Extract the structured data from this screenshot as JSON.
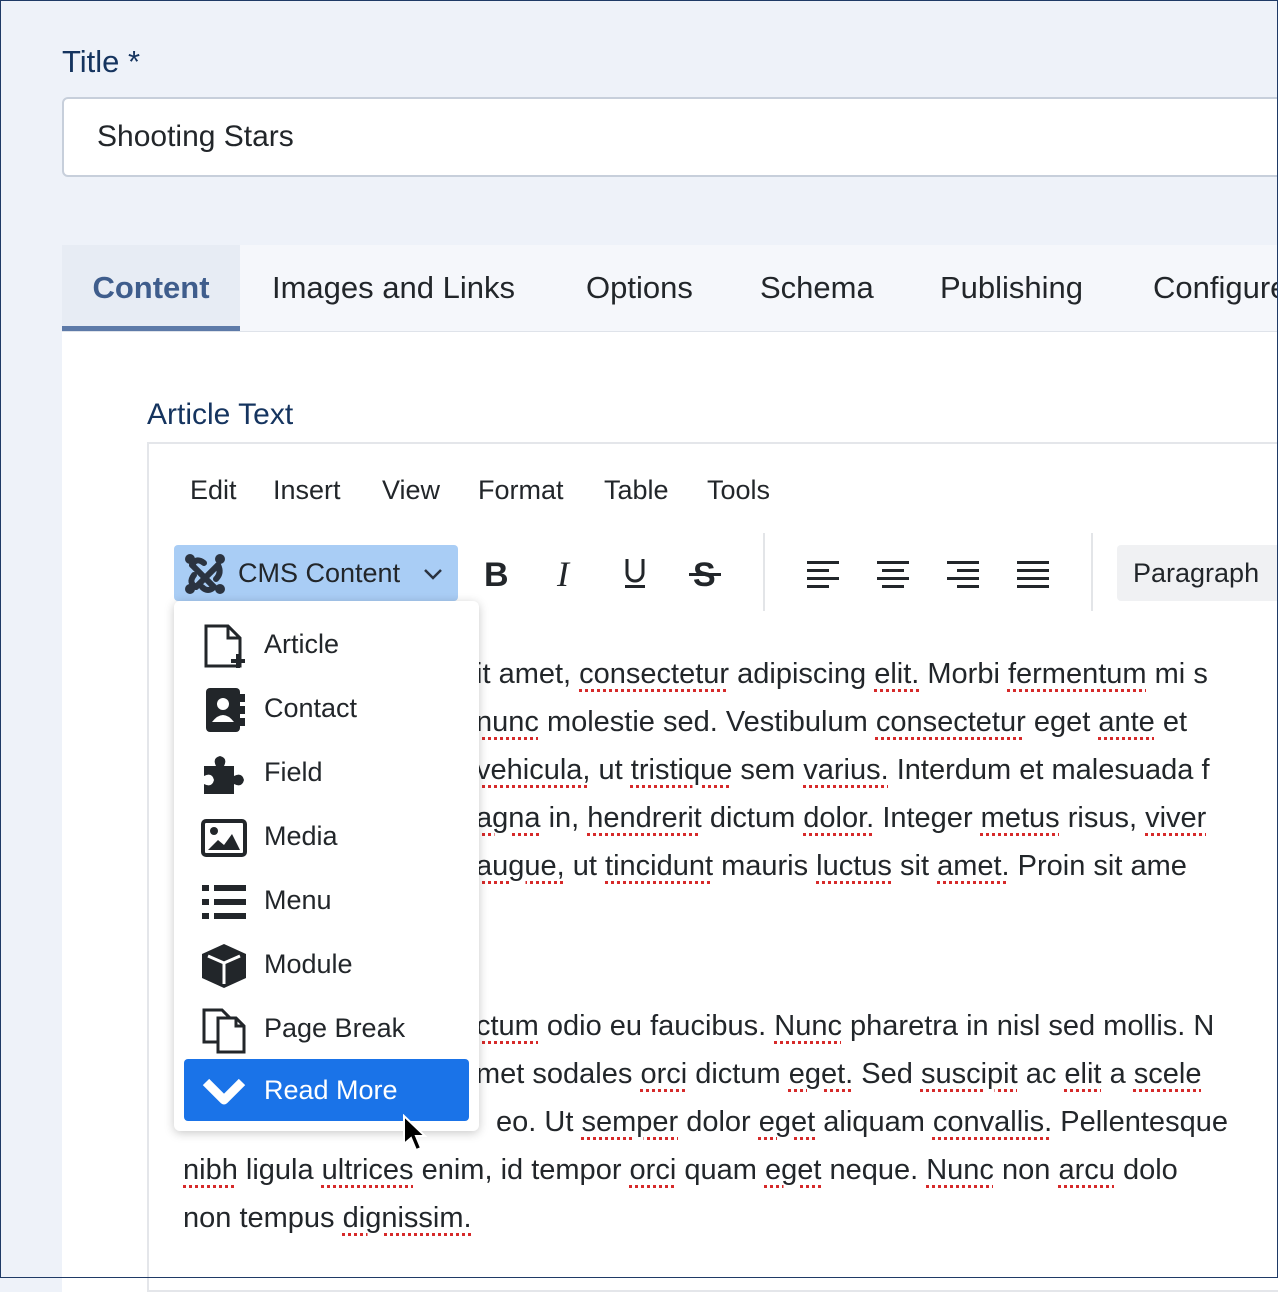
{
  "title_field": {
    "label": "Title *",
    "value": "Shooting Stars"
  },
  "tabs": [
    {
      "label": "Content"
    },
    {
      "label": "Images and Links"
    },
    {
      "label": "Options"
    },
    {
      "label": "Schema"
    },
    {
      "label": "Publishing"
    },
    {
      "label": "Configure"
    }
  ],
  "article_text_label": "Article Text",
  "editor": {
    "menu": [
      "Edit",
      "Insert",
      "View",
      "Format",
      "Table",
      "Tools"
    ],
    "cms_content_label": "CMS Content",
    "block_format": "Paragraph",
    "toolbar_icons": [
      "bold-icon",
      "italic-icon",
      "underline-icon",
      "strikethrough-icon",
      "align-left-icon",
      "align-center-icon",
      "align-right-icon",
      "align-justify-icon"
    ]
  },
  "dropdown": {
    "items": [
      {
        "label": "Article",
        "icon": "file-plus-icon"
      },
      {
        "label": "Contact",
        "icon": "address-book-icon"
      },
      {
        "label": "Field",
        "icon": "puzzle-icon"
      },
      {
        "label": "Media",
        "icon": "image-icon"
      },
      {
        "label": "Menu",
        "icon": "list-icon"
      },
      {
        "label": "Module",
        "icon": "cube-icon"
      },
      {
        "label": "Page Break",
        "icon": "copy-icon"
      },
      {
        "label": "Read More",
        "icon": "chevron-down-icon"
      }
    ],
    "selected": "Read More"
  },
  "body_lines": {
    "p1": [
      "it amet, consectetur adipiscing elit. Morbi fermentum mi s",
      "nunc molestie sed. Vestibulum consectetur eget ante et",
      "vehicula, ut tristique sem varius. Interdum et malesuada f",
      "agna in, hendrerit dictum dolor. Integer metus risus, viver",
      "augue, ut tincidunt mauris luctus sit amet. Proin sit ame"
    ],
    "p2": [
      "ctum odio eu faucibus. Nunc pharetra in nisl sed mollis. N",
      "met sodales orci dictum eget. Sed suscipit ac elit a scele",
      "eo. Ut semper dolor eget aliquam convallis. Pellentesque",
      "nibh ligula ultrices enim, id tempor orci quam eget neque. Nunc non arcu dolo",
      "non tempus dignissim."
    ]
  },
  "colors": {
    "accent": "#1a73e8",
    "cms_button": "#a9cdf5",
    "tab_active_text": "#3f5d8c",
    "heading": "#15345f"
  }
}
